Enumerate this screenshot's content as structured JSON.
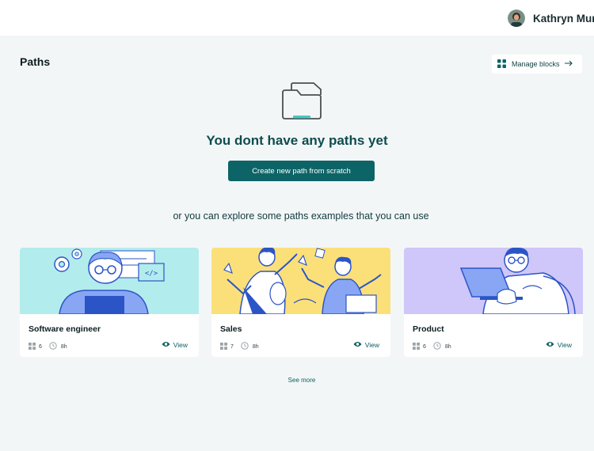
{
  "header": {
    "user_name": "Kathryn Murphy"
  },
  "page": {
    "title": "Paths",
    "manage_blocks_label": "Manage blocks",
    "empty_title": "You dont have any paths yet",
    "create_button_label": "Create new path from scratch",
    "explore_text": "or you can explore some paths examples that you can use",
    "see_more_label": "See more"
  },
  "cards": [
    {
      "title": "Software engineer",
      "blocks": "6",
      "duration": "8h",
      "view_label": "View",
      "color": "#b3ecec"
    },
    {
      "title": "Sales",
      "blocks": "7",
      "duration": "8h",
      "view_label": "View",
      "color": "#fbe07a"
    },
    {
      "title": "Product",
      "blocks": "6",
      "duration": "8h",
      "view_label": "View",
      "color": "#cfc6f9"
    }
  ],
  "colors": {
    "accent": "#0d6466",
    "background": "#f3f6f7"
  }
}
